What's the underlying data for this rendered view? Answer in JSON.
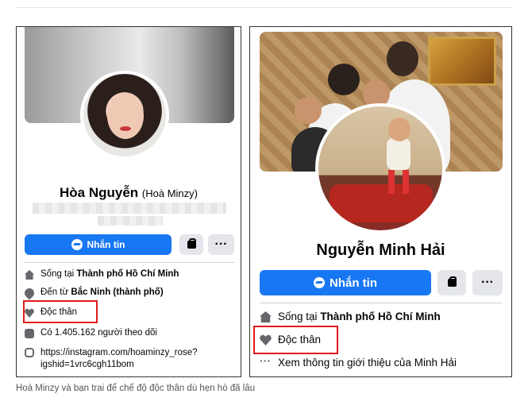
{
  "left": {
    "name_main": "Hòa Nguyễn",
    "name_alt": "(Hoà Minzy)",
    "message_button": "Nhắn tin",
    "more_button": "···",
    "info": {
      "lives_prefix": "Sống tại",
      "lives_city": "Thành phố Hồ Chí Minh",
      "from_prefix": "Đến từ",
      "from_city": "Bắc Ninh (thành phố)",
      "relationship": "Độc thân",
      "followers": "Có 1.405.162 người theo dõi",
      "instagram_line1": "https://instagram.com/hoaminzy_rose?",
      "instagram_line2": "igshid=1vrc6cgh11bom"
    }
  },
  "right": {
    "name": "Nguyễn Minh Hải",
    "message_button": "Nhắn tin",
    "more_button": "···",
    "info": {
      "lives_prefix": "Sống tại",
      "lives_city": "Thành phố Hồ Chí Minh",
      "relationship": "Độc thân",
      "see_more": "Xem thông tin giới thiệu của Minh Hải"
    }
  },
  "caption": "Hoà Minzy và bạn trai để chế độ độc thân dù hẹn hò đã lâu",
  "colors": {
    "primary": "#1877f2",
    "highlight": "#e01b1b"
  },
  "icons": [
    "home-icon",
    "location-pin-icon",
    "heart-icon",
    "rss-icon",
    "instagram-icon",
    "more-dots-icon",
    "messenger-icon",
    "shopping-bag-icon"
  ]
}
